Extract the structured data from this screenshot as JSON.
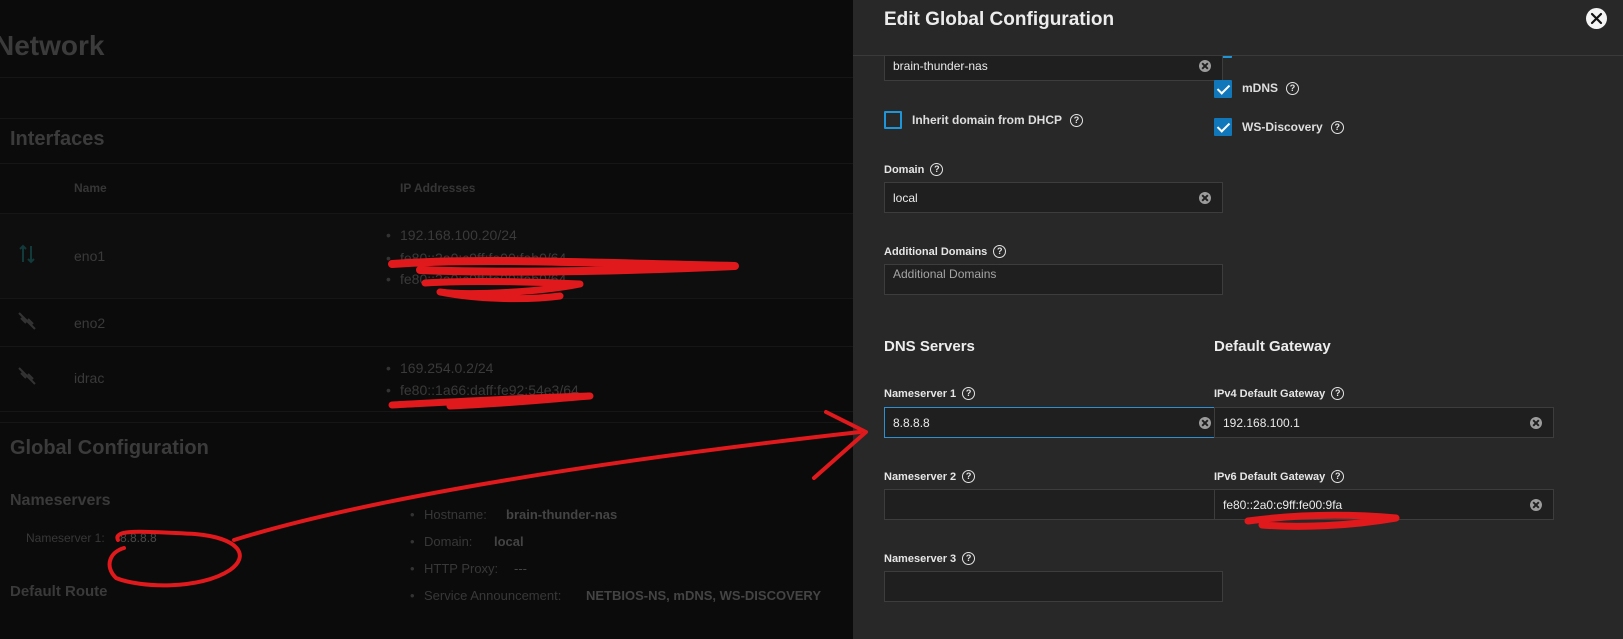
{
  "page": {
    "title": "Network",
    "interfaces": {
      "title": "Interfaces",
      "columns": [
        "Name",
        "IP Addresses"
      ],
      "rows": [
        {
          "name": "eno1",
          "ips": [
            "192.168.100.20/24",
            "fe80::2a0:c9ff:fe00:fab0/64",
            "fe80::2a0:c9ff:fe00:fab0/64"
          ],
          "icon": "arrows-updown-icon"
        },
        {
          "name": "eno2",
          "ips": [],
          "icon": "link-off-icon"
        },
        {
          "name": "idrac",
          "ips": [
            "169.254.0.2/24",
            "fe80::1a66:daff:fe92:54e3/64"
          ],
          "icon": "link-off-icon"
        }
      ]
    },
    "global": {
      "title": "Global Configuration",
      "nameservers_title": "Nameservers",
      "nameserver1_label": "Nameserver 1:",
      "nameserver1_value": "8.8.8.8",
      "default_route_title": "Default Route",
      "hostname_label": "Hostname:",
      "hostname_value": "brain-thunder-nas",
      "domain_label": "Domain:",
      "domain_value": "local",
      "proxy_label": "HTTP Proxy:",
      "proxy_value": "---",
      "service_label": "Service Announcement:",
      "service_value": "NETBIOS-NS, mDNS, WS-DISCOVERY"
    }
  },
  "panel": {
    "title": "Edit Global Configuration",
    "hostname_value": "brain-thunder-nas",
    "inherit_domain_label": "Inherit domain from DHCP",
    "inherit_domain_checked": false,
    "mdns_label": "mDNS",
    "mdns_checked": true,
    "wsd_label": "WS-Discovery",
    "wsd_checked": true,
    "domain_label": "Domain",
    "domain_value": "local",
    "additional_domains_label": "Additional Domains",
    "additional_domains_placeholder": "Additional Domains",
    "dns_title": "DNS Servers",
    "gateway_title": "Default Gateway",
    "ns1_label": "Nameserver 1",
    "ns1_value": "8.8.8.8",
    "ns2_label": "Nameserver 2",
    "ns2_value": "",
    "ns3_label": "Nameserver 3",
    "ns3_value": "",
    "ipv4_gw_label": "IPv4 Default Gateway",
    "ipv4_gw_value": "192.168.100.1",
    "ipv6_gw_label": "IPv6 Default Gateway",
    "ipv6_gw_value": "fe80::2a0:c9ff:fe00:9fa"
  },
  "colors": {
    "accent": "#1177bb",
    "focus_border": "#2f8fd0",
    "annotation": "#e0191c"
  }
}
